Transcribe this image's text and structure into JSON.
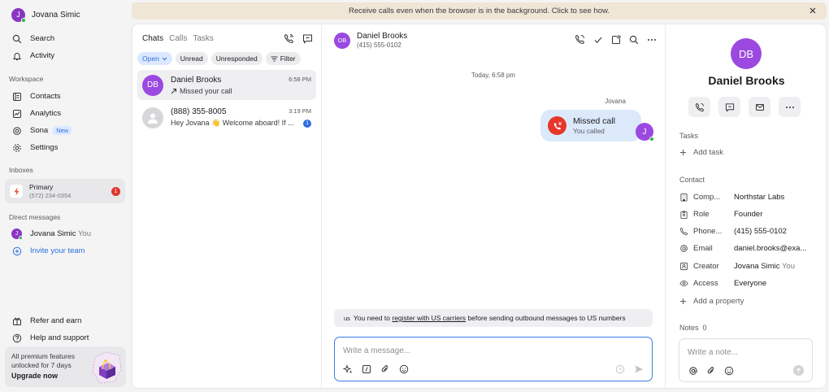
{
  "sidebar": {
    "user": {
      "initial": "J",
      "name": "Jovana Simic"
    },
    "nav_top": [
      {
        "label": "Search",
        "icon": "search-icon"
      },
      {
        "label": "Activity",
        "icon": "bell-icon"
      }
    ],
    "workspace_label": "Workspace",
    "workspace": [
      {
        "label": "Contacts",
        "icon": "contacts-icon"
      },
      {
        "label": "Analytics",
        "icon": "analytics-icon"
      },
      {
        "label": "Sona",
        "icon": "sona-icon",
        "badge": "New"
      },
      {
        "label": "Settings",
        "icon": "gear-icon"
      }
    ],
    "inboxes_label": "Inboxes",
    "inbox": {
      "name": "Primary",
      "number": "(572) 234-0354",
      "count": "1"
    },
    "dm_label": "Direct messages",
    "dm": {
      "initial": "J",
      "name": "Jovana Simic",
      "suffix": "You"
    },
    "invite": "Invite your team",
    "bottom": [
      {
        "label": "Refer and earn",
        "icon": "gift-icon"
      },
      {
        "label": "Help and support",
        "icon": "help-icon"
      }
    ],
    "premium": {
      "line1": "All premium features",
      "line2": "unlocked for 7 days",
      "cta": "Upgrade now"
    }
  },
  "banner": {
    "text": "Receive calls even when the browser is in the background. Click to see how."
  },
  "list": {
    "tabs": [
      "Chats",
      "Calls",
      "Tasks"
    ],
    "chips": [
      "Open",
      "Unread",
      "Unresponded",
      "Filter"
    ],
    "conversations": [
      {
        "initials": "DB",
        "name": "Daniel Brooks",
        "time": "6:58 PM",
        "preview": "Missed your call"
      },
      {
        "name": "(888) 355-8005",
        "time": "3:19 PM",
        "preview": "Hey Jovana 👋 Welcome aboard! If ...",
        "unread": "1"
      }
    ]
  },
  "chat": {
    "initials": "DB",
    "name": "Daniel Brooks",
    "phone": "(415) 555-0102",
    "day": "Today, 6:58 pm",
    "sender": "Jovana",
    "bubble_title": "Missed call",
    "bubble_sub": "You called",
    "me_initial": "J",
    "notice_prefix": "us",
    "notice_a": "You need to ",
    "notice_link": "register with US carriers",
    "notice_b": " before sending outbound messages to US numbers",
    "placeholder": "Write a message..."
  },
  "info": {
    "initials": "DB",
    "name": "Daniel Brooks",
    "tasks_label": "Tasks",
    "add_task": "Add task",
    "contact_label": "Contact",
    "props": [
      {
        "key": "Comp...",
        "value": "Northstar Labs",
        "icon": "building-icon"
      },
      {
        "key": "Role",
        "value": "Founder",
        "icon": "badge-icon"
      },
      {
        "key": "Phone...",
        "value": "(415) 555-0102",
        "icon": "phone-icon"
      },
      {
        "key": "Email",
        "value": "daniel.brooks@exa...",
        "icon": "at-icon"
      },
      {
        "key": "Creator",
        "value": "Jovana Simic",
        "suffix": "You",
        "icon": "person-icon"
      },
      {
        "key": "Access",
        "value": "Everyone",
        "icon": "eye-icon"
      }
    ],
    "add_property": "Add a property",
    "notes_label": "Notes",
    "notes_count": "0",
    "note_placeholder": "Write a note..."
  }
}
